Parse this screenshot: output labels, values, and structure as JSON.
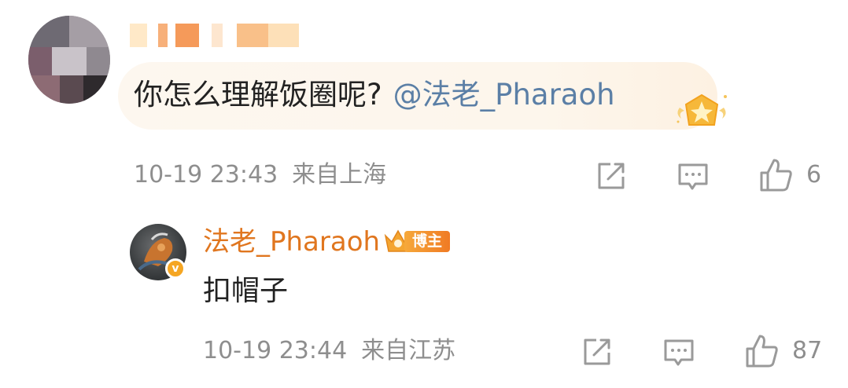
{
  "comment": {
    "text": "你怎么理解饭圈呢?",
    "mention": "@法老_Pharaoh",
    "timestamp": "10-19 23:43",
    "location": "来自上海",
    "like_count": "6"
  },
  "reply": {
    "author": "法老_Pharaoh",
    "host_badge": "博主",
    "verified_mark": "v",
    "text": "扣帽子",
    "timestamp": "10-19 23:44",
    "location": "来自江苏",
    "like_count": "87"
  },
  "icons": [
    "share-icon",
    "comment-icon",
    "like-icon",
    "star-badge-icon",
    "crown-icon"
  ],
  "colors": {
    "mention": "#5b7fa6",
    "author": "#e0761f",
    "meta": "#8e8e8e",
    "bubble": "#fdf7ef",
    "badge": "#f07a24"
  }
}
